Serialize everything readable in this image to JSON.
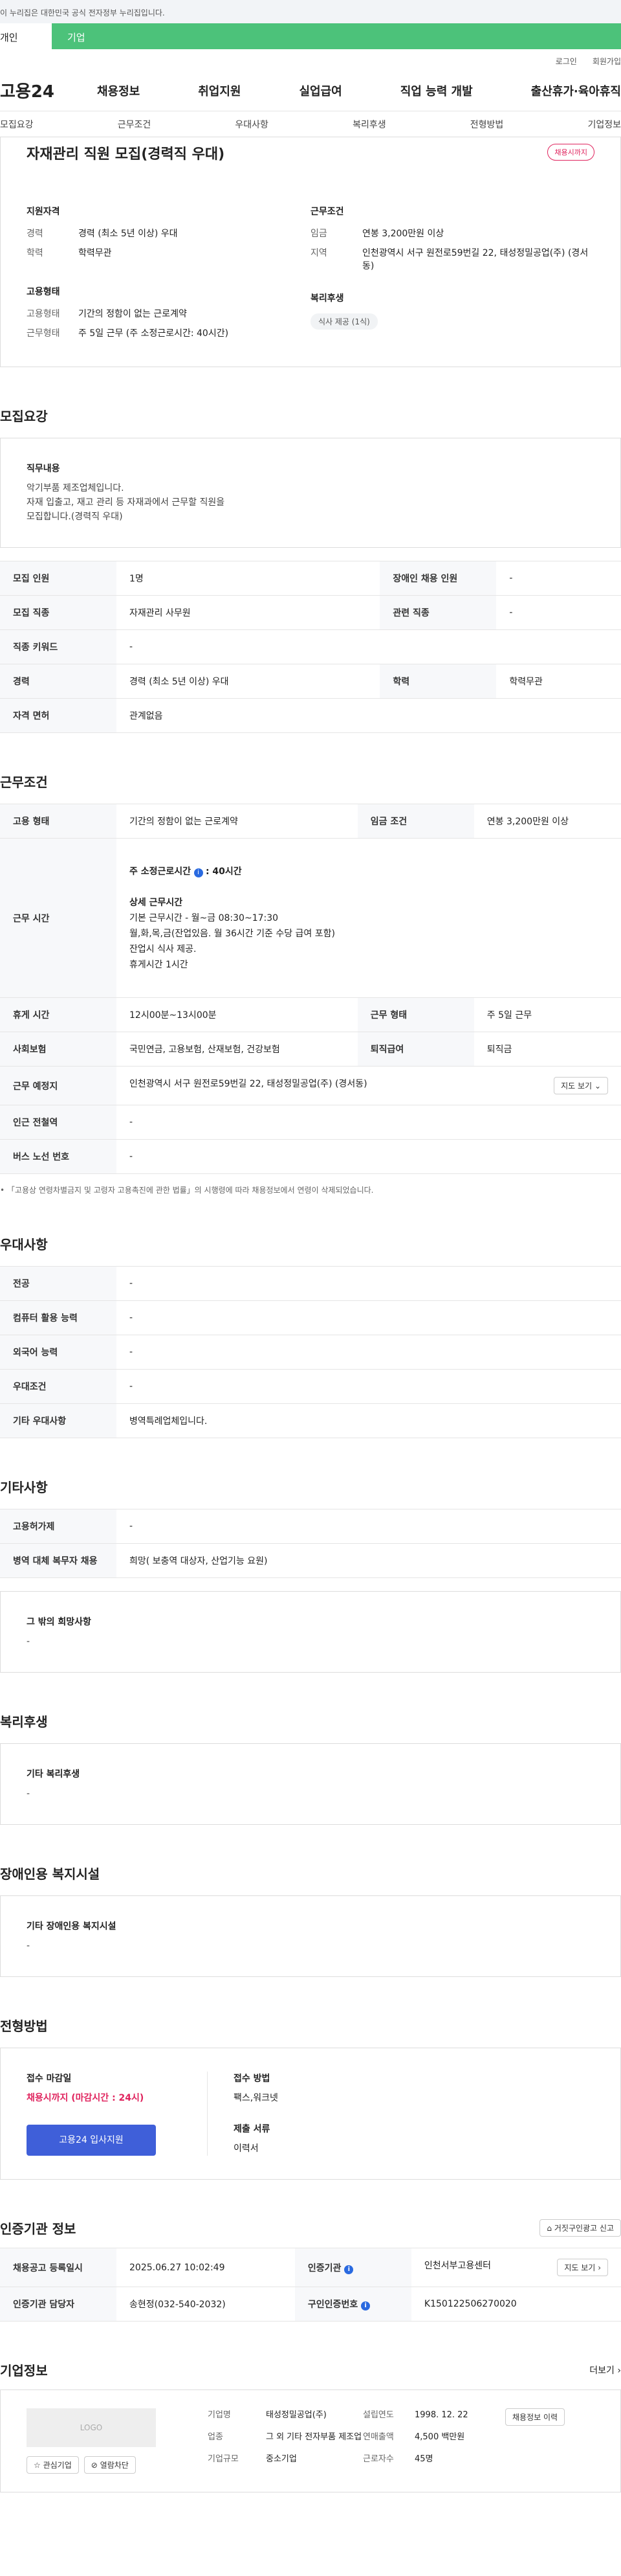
{
  "gov_notice": "이 누리집은 대한민국 공식 전자정부 누리집입니다.",
  "user_tabs": {
    "personal": "개인",
    "company": "기업"
  },
  "util": {
    "login": "로그인",
    "join": "회원가입"
  },
  "logo": "고용24",
  "gnb": [
    "채용정보",
    "취업지원",
    "실업급여",
    "직업 능력 개발",
    "출산휴가·육아휴직"
  ],
  "subnav": [
    "모집요강",
    "근무조건",
    "우대사항",
    "복리후생",
    "전형방법",
    "기업정보"
  ],
  "job": {
    "title": "자재관리 직원 모집(경력직 우대)",
    "deadline_badge": "채용시까지",
    "qual_h": "지원자격",
    "qual": [
      {
        "k": "경력",
        "v": "경력 (최소 5년 이상) 우대"
      },
      {
        "k": "학력",
        "v": "학력무관"
      }
    ],
    "emp_h": "고용형태",
    "emp": [
      {
        "k": "고용형태",
        "v": "기간의 정함이 없는 근로계약"
      },
      {
        "k": "근무형태",
        "v": "주 5일 근무 (주 소정근로시간: 40시간)"
      }
    ],
    "cond_h": "근무조건",
    "cond": [
      {
        "k": "임금",
        "v": "연봉 3,200만원 이상"
      },
      {
        "k": "지역",
        "v": "인천광역시 서구 원전로59번길 22, 태성정밀공업(주) (경서동)"
      }
    ],
    "welfare_h": "복리후생",
    "welfare_tag": "식사 제공 (1식)"
  },
  "recruit": {
    "title": "모집요강",
    "duty_h": "직무내용",
    "duty": "악기부품 제조업체입니다.\n자재 입출고, 재고 관리 등 자재과에서 근무할 직원을\n모집합니다.(경력직 우대)",
    "rows": [
      [
        "모집 인원",
        "1명",
        "장애인 채용 인원",
        "-"
      ],
      [
        "모집 직종",
        "자재관리 사무원",
        "관련 직종",
        "-"
      ],
      [
        "직종 키워드",
        "-"
      ],
      [
        "경력",
        "경력 (최소 5년 이상) 우대",
        "학력",
        "학력무관"
      ],
      [
        "자격 면허",
        "관계없음"
      ]
    ]
  },
  "work": {
    "title": "근무조건",
    "row1": [
      "고용 형태",
      "기간의 정함이 없는 근로계약",
      "임금 조건",
      "연봉 3,200만원 이상"
    ],
    "time_k": "근무 시간",
    "time_main": "주 소정근로시간",
    "time_main_v": ": 40시간",
    "time_detail_h": "상세 근무시간",
    "time_detail": "기본 근무시간 - 월~금 08:30~17:30\n월,화,목,금(잔업있음. 월 36시간 기준 수당 급여 포함)\n잔업시 식사 제공.\n휴게시간 1시간",
    "row3": [
      "휴게 시간",
      "12시00분~13시00분",
      "근무 형태",
      "주 5일 근무"
    ],
    "row4": [
      "사회보험",
      "국민연금, 고용보험, 산재보험, 건강보험",
      "퇴직급여",
      "퇴직금"
    ],
    "place_k": "근무 예정지",
    "place_v": "인천광역시 서구 원전로59번길 22, 태성정밀공업(주) (경서동)",
    "map_btn": "지도 보기",
    "subway": [
      "인근 전철역",
      "-"
    ],
    "bus": [
      "버스 노선 번호",
      "-"
    ],
    "footnote": "「고용상 연령차별금지 및 고령자 고용촉진에 관한 법률」의 시행령에 따라 채용정보에서 연령이 삭제되었습니다."
  },
  "pref": {
    "title": "우대사항",
    "rows": [
      [
        "전공",
        "-"
      ],
      [
        "컴퓨터 활용 능력",
        "-"
      ],
      [
        "외국어 능력",
        "-"
      ],
      [
        "우대조건",
        "-"
      ],
      [
        "기타 우대사항",
        "병역특례업체입니다."
      ]
    ]
  },
  "etc": {
    "title": "기타사항",
    "rows": [
      [
        "고용허가제",
        "-"
      ],
      [
        "병역 대체 복무자 채용",
        "희망( 보충역 대상자, 산업기능 요원)"
      ]
    ],
    "hope_h": "그 밖의 희망사항",
    "hope_v": "-"
  },
  "welfare": {
    "title": "복리후생",
    "h": "기타 복리후생",
    "v": "-"
  },
  "disabled": {
    "title": "장애인용 복지시설",
    "h": "기타 장애인용 복지시설",
    "v": "-"
  },
  "apply": {
    "title": "전형방법",
    "deadline_h": "접수 마감일",
    "deadline_v": "채용시까지 (마감시간 : 24시)",
    "btn": "고용24 입사지원",
    "method_h": "접수 방법",
    "method_v": "팩스,워크넷",
    "docs_h": "제출 서류",
    "docs_v": "이력서"
  },
  "agency": {
    "title": "인증기관 정보",
    "report_btn": "거짓구인광고 신고",
    "row1": [
      "채용공고 등록일시",
      "2025.06.27 10:02:49",
      "인증기관",
      "인천서부고용센터"
    ],
    "map_btn": "지도 보기",
    "row2": [
      "인증기관 담당자",
      "송현정(032-540-2032)",
      "구인인증번호",
      "K150122506270020"
    ]
  },
  "company": {
    "title": "기업정보",
    "more": "더보기",
    "logo_text": "LOGO",
    "fav_btn": "관심기업",
    "block_btn": "열람차단",
    "info_btn": "채용정보 이력",
    "fields": [
      {
        "k": "기업명",
        "v": "태성정밀공업(주)"
      },
      {
        "k": "업종",
        "v": "그 외 기타 전자부품 제조업"
      },
      {
        "k": "기업규모",
        "v": "중소기업"
      }
    ],
    "fields2": [
      {
        "k": "설립연도",
        "v": "1998. 12. 22"
      },
      {
        "k": "연매출액",
        "v": "4,500 백만원"
      },
      {
        "k": "근로자수",
        "v": "45명"
      }
    ]
  }
}
